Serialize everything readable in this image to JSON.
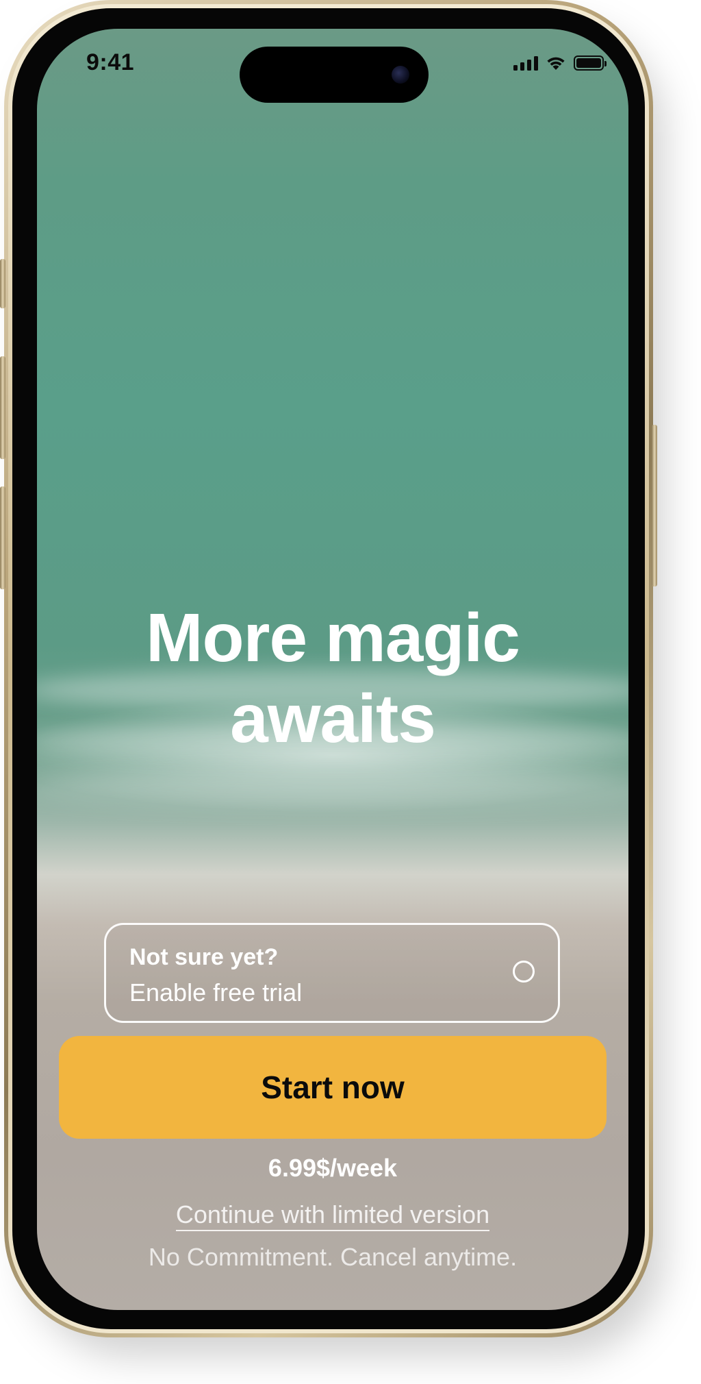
{
  "status_bar": {
    "time": "9:41"
  },
  "hero": {
    "headline_line1": "More magic",
    "headline_line2": "awaits"
  },
  "trial": {
    "title": "Not sure yet?",
    "subtitle": "Enable free trial",
    "enabled": false
  },
  "cta": {
    "start_label": "Start now",
    "price": "6.99$/week",
    "limited_label": "Continue with limited version",
    "disclaimer": "No Commitment. Cancel anytime."
  },
  "colors": {
    "cta_background": "#f2b53f",
    "text_light": "#ffffff",
    "text_dark": "#0b0b0b"
  },
  "icons": {
    "signal": "cellular-signal-icon",
    "wifi": "wifi-icon",
    "battery": "battery-icon",
    "radio": "radio-unchecked-icon"
  }
}
